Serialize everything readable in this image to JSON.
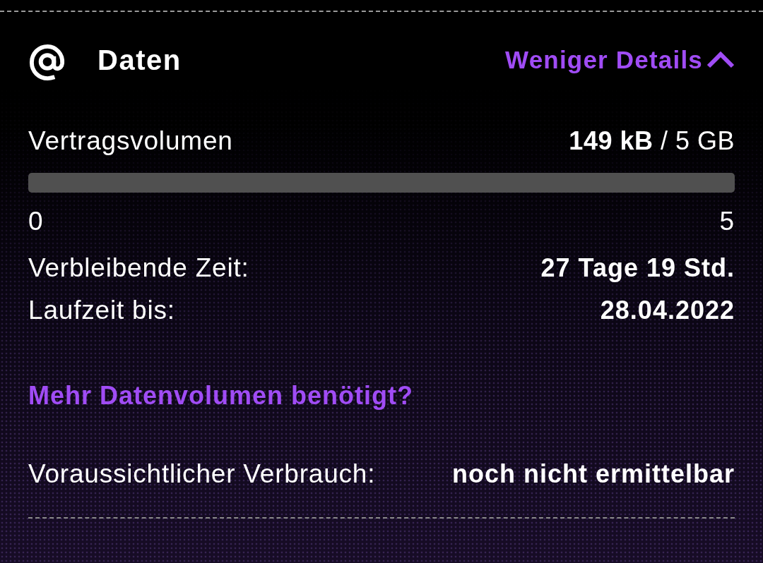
{
  "header": {
    "title": "Daten",
    "toggle": {
      "label": "Weniger Details",
      "expanded": true
    }
  },
  "volume": {
    "label": "Vertragsvolumen",
    "amount": "**149 kB** / 5 GB",
    "level": 0,
    "scale_min": "0",
    "scale_max": "5"
  },
  "details": [
    {
      "label": "Verbleibende Zeit:",
      "value": "27 Tage 19 Std."
    },
    {
      "label": "Laufzeit bis:",
      "value": "28.04.2022"
    }
  ],
  "more_link": "Mehr Datenvolumen benötigt?",
  "forecast": {
    "label": "Voraussichtlicher Verbrauch:",
    "value": "noch nicht ermittelbar"
  }
}
